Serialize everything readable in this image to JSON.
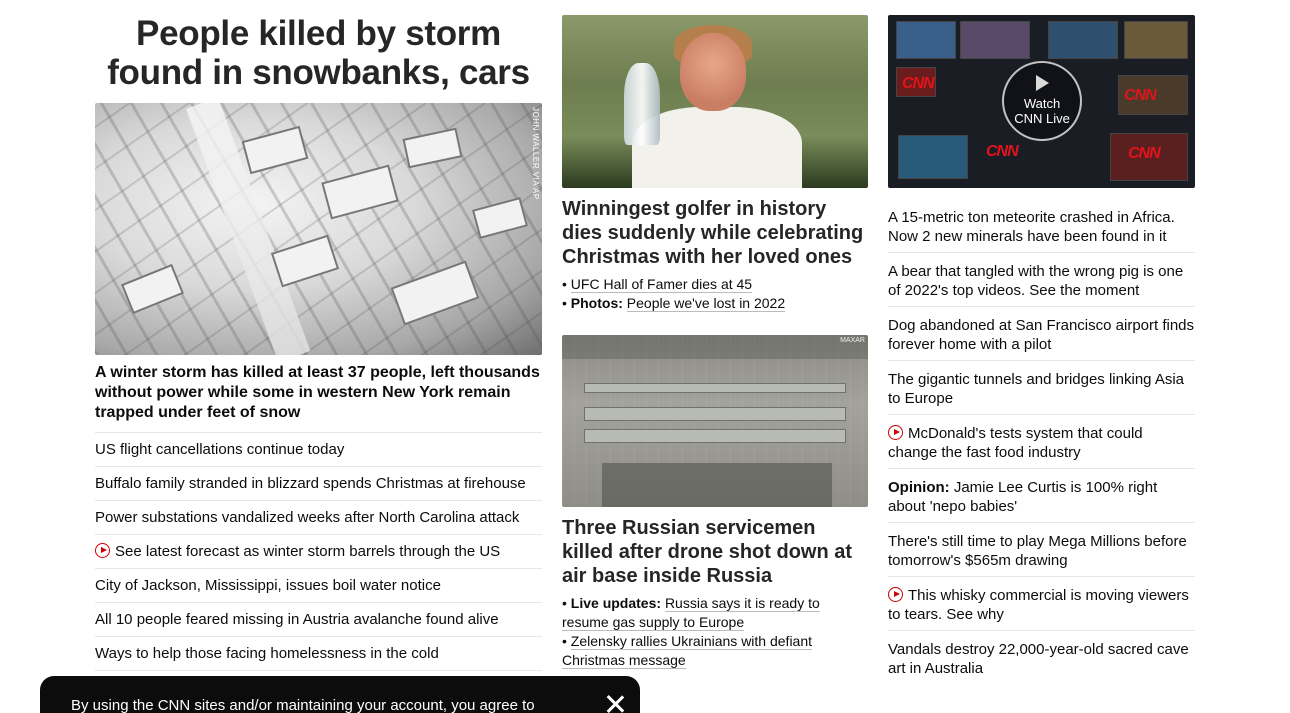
{
  "col1": {
    "headline": "People killed by storm found in snowbanks, cars",
    "image_credit": "JOHN WALLER VIA AP",
    "lead": "A winter storm has killed at least 37 people, left thousands without power while some in western New York remain trapped under feet of snow",
    "items": [
      "US flight cancellations continue today",
      "Buffalo family stranded in blizzard spends Christmas at firehouse",
      "Power substations vandalized weeks after North Carolina attack",
      "See latest forecast as winter storm barrels through the US",
      "City of Jackson, Mississippi, issues boil water notice",
      "All 10 people feared missing in Austria avalanche found alive",
      "Ways to help those facing homelessness in the cold"
    ]
  },
  "col2": {
    "story1": {
      "headline": "Winningest golfer in history dies suddenly while celebrating Christmas with her loved ones",
      "sub1": "UFC Hall of Famer dies at 45",
      "sub2_label": "Photos:",
      "sub2": "People we've lost in 2022"
    },
    "story2": {
      "image_tag": "MAXAR",
      "headline": "Three Russian servicemen killed after drone shot down at air base inside Russia",
      "sub1_label": "Live updates:",
      "sub1": "Russia says it is ready to resume gas supply to Europe",
      "sub2": "Zelensky rallies Ukrainians with defiant Christmas message"
    }
  },
  "col3": {
    "watch_line1": "Watch",
    "watch_line2": "CNN Live",
    "cnn": "CNN",
    "items": [
      "A 15-metric ton meteorite crashed in Africa. Now 2 new minerals have been found in it",
      "A bear that tangled with the wrong pig is one of 2022's top videos. See the moment",
      "Dog abandoned at San Francisco airport finds forever home with a pilot",
      "The gigantic tunnels and bridges linking Asia to Europe",
      "McDonald's tests system that could change the fast food industry",
      "Jamie Lee Curtis is 100% right about 'nepo babies'",
      "There's still time to play Mega Millions before tomorrow's $565m drawing",
      "This whisky commercial is moving viewers to tears. See why",
      "Vandals destroy 22,000-year-old sacred cave art in Australia"
    ],
    "opinion_label": "Opinion:"
  },
  "banner": {
    "text": "By using the CNN sites and/or maintaining your account, you agree to"
  },
  "icons": {
    "video": "play-circle-icon",
    "close": "close-icon"
  },
  "colors": {
    "accent": "#cc0000",
    "banner_bg": "#0c0c0c"
  }
}
